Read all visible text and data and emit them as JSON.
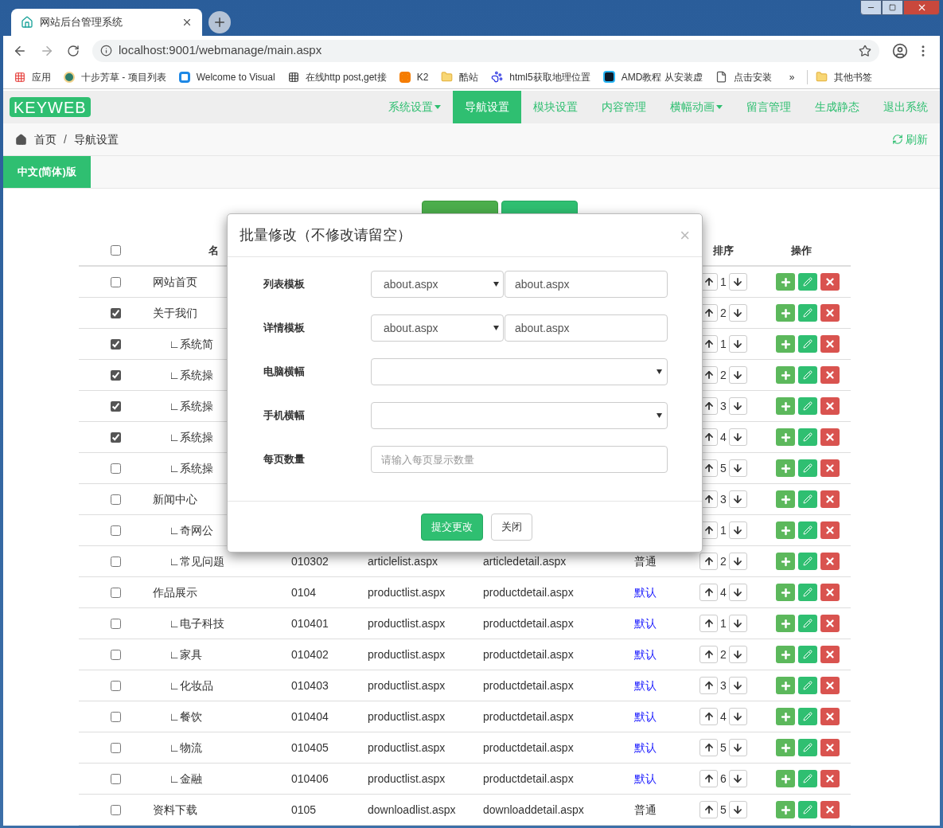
{
  "browser": {
    "tab_title": "网站后台管理系统",
    "url": "localhost:9001/webmanage/main.aspx",
    "bookmarks": [
      {
        "label": "应用",
        "kind": "apps"
      },
      {
        "label": "十步芳草 - 项目列表",
        "kind": "badge"
      },
      {
        "label": "Welcome to Visual",
        "kind": "vs"
      },
      {
        "label": "在线http post,get接",
        "kind": "qr"
      },
      {
        "label": "K2",
        "kind": "k2"
      },
      {
        "label": "酷站",
        "kind": "folder"
      },
      {
        "label": "html5获取地理位置",
        "kind": "paw"
      },
      {
        "label": "AMD教程 从安装虚",
        "kind": "amd"
      },
      {
        "label": "点击安装",
        "kind": "page"
      }
    ],
    "more": "»",
    "other": "其他书签"
  },
  "logo": "KEYWEB",
  "nav": [
    {
      "label": "系统设置",
      "selected": false,
      "dropdown": true
    },
    {
      "label": "导航设置",
      "selected": true,
      "dropdown": false
    },
    {
      "label": "模块设置",
      "selected": false,
      "dropdown": false
    },
    {
      "label": "内容管理",
      "selected": false,
      "dropdown": false
    },
    {
      "label": "横幅动画",
      "selected": false,
      "dropdown": true
    },
    {
      "label": "留言管理",
      "selected": false,
      "dropdown": false
    },
    {
      "label": "生成静态",
      "selected": false,
      "dropdown": false
    },
    {
      "label": "退出系统",
      "selected": false,
      "dropdown": false
    }
  ],
  "breadcrumb": [
    "首页",
    "/",
    "导航设置"
  ],
  "refresh": "刷新",
  "language_tab": "中文(简体)版",
  "toolbar": [
    {
      "kind": "add"
    },
    {
      "kind": "edit"
    }
  ],
  "table": {
    "all_checked": false,
    "columns": [
      "名",
      "排序",
      "操作"
    ],
    "rows": [
      {
        "name": "网站首页",
        "checked": false,
        "sort": "1"
      },
      {
        "name": "关于我们",
        "checked": true,
        "sort": "2",
        "children": [
          {
            "name": "∟系统简",
            "checked": true,
            "sort": "1"
          },
          {
            "name": "∟系统操",
            "checked": true,
            "sort": "2"
          },
          {
            "name": "∟系统操",
            "checked": true,
            "sort": "3"
          },
          {
            "name": "∟系统操",
            "checked": true,
            "sort": "4"
          },
          {
            "name": "∟系统操",
            "checked": false,
            "sort": "5"
          }
        ]
      },
      {
        "name": "新闻中心",
        "checked": false,
        "sort": "3",
        "children": [
          {
            "name": "∟奇网公",
            "checked": false,
            "sort": "1"
          },
          {
            "name": "∟常见问题",
            "checked": false,
            "code": "010302",
            "list": "articlelist.aspx",
            "detail": "articledetail.aspx",
            "type": "普通",
            "kind": "normal",
            "sort": "2"
          }
        ]
      },
      {
        "name": "作品展示",
        "checked": false,
        "code": "0104",
        "list": "productlist.aspx",
        "detail": "productdetail.aspx",
        "type": "默认",
        "kind": "default",
        "sort": "4",
        "children": [
          {
            "name": "∟电子科技",
            "checked": false,
            "code": "010401",
            "list": "productlist.aspx",
            "detail": "productdetail.aspx",
            "type": "默认",
            "kind": "default",
            "sort": "1"
          },
          {
            "name": "∟家具",
            "checked": false,
            "code": "010402",
            "list": "productlist.aspx",
            "detail": "productdetail.aspx",
            "type": "默认",
            "kind": "default",
            "sort": "2"
          },
          {
            "name": "∟化妆品",
            "checked": false,
            "code": "010403",
            "list": "productlist.aspx",
            "detail": "productdetail.aspx",
            "type": "默认",
            "kind": "default",
            "sort": "3"
          },
          {
            "name": "∟餐饮",
            "checked": false,
            "code": "010404",
            "list": "productlist.aspx",
            "detail": "productdetail.aspx",
            "type": "默认",
            "kind": "default",
            "sort": "4"
          },
          {
            "name": "∟物流",
            "checked": false,
            "code": "010405",
            "list": "productlist.aspx",
            "detail": "productdetail.aspx",
            "type": "默认",
            "kind": "default",
            "sort": "5"
          },
          {
            "name": "∟金融",
            "checked": false,
            "code": "010406",
            "list": "productlist.aspx",
            "detail": "productdetail.aspx",
            "type": "默认",
            "kind": "default",
            "sort": "6"
          }
        ]
      },
      {
        "name": "资料下载",
        "checked": false,
        "code": "0105",
        "list": "downloadlist.aspx",
        "detail": "downloaddetail.aspx",
        "type": "普通",
        "kind": "normal",
        "sort": "5"
      }
    ]
  },
  "modal": {
    "title": "批量修改（不修改请留空）",
    "close": "×",
    "fields": [
      {
        "label": "列表模板",
        "kind": "select_pair",
        "value": "about.aspx",
        "text": "about.aspx"
      },
      {
        "label": "详情模板",
        "kind": "select_pair",
        "value": "about.aspx",
        "text": "about.aspx"
      },
      {
        "label": "电脑横幅",
        "kind": "select"
      },
      {
        "label": "手机横幅",
        "kind": "select"
      },
      {
        "label": "每页数量",
        "kind": "input",
        "placeholder": "请输入每页显示数量"
      }
    ],
    "buttons": [
      {
        "label": "提交更改",
        "kind": "primary"
      },
      {
        "label": "关闭",
        "kind": "default"
      }
    ]
  }
}
